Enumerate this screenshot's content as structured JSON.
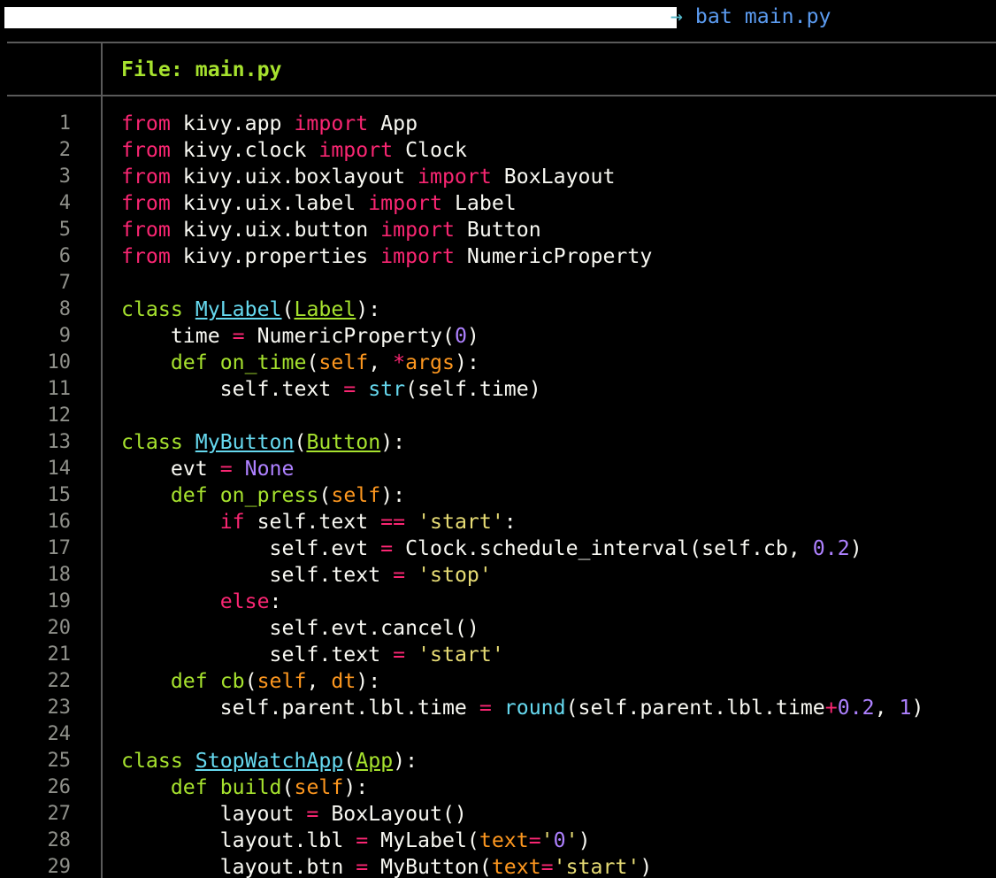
{
  "terminal": {
    "prompt_arrow": "→",
    "command": " bat main.py"
  },
  "header": {
    "label": "File: ",
    "filename": "main.py"
  },
  "colors": {
    "keyword": "#f92672",
    "function": "#a6e22e",
    "class": "#66d9ef",
    "number": "#ae81ff",
    "string": "#e6db74",
    "parameter": "#fd971f",
    "text": "#f8f8f2",
    "line_number": "#8f908a",
    "rule": "#5a5a5a"
  },
  "lines": [
    [
      [
        "kw",
        "from"
      ],
      [
        "tx",
        " kivy.app "
      ],
      [
        "kw",
        "import"
      ],
      [
        "tx",
        " App"
      ]
    ],
    [
      [
        "kw",
        "from"
      ],
      [
        "tx",
        " kivy.clock "
      ],
      [
        "kw",
        "import"
      ],
      [
        "tx",
        " Clock"
      ]
    ],
    [
      [
        "kw",
        "from"
      ],
      [
        "tx",
        " kivy.uix.boxlayout "
      ],
      [
        "kw",
        "import"
      ],
      [
        "tx",
        " BoxLayout"
      ]
    ],
    [
      [
        "kw",
        "from"
      ],
      [
        "tx",
        " kivy.uix.label "
      ],
      [
        "kw",
        "import"
      ],
      [
        "tx",
        " Label"
      ]
    ],
    [
      [
        "kw",
        "from"
      ],
      [
        "tx",
        " kivy.uix.button "
      ],
      [
        "kw",
        "import"
      ],
      [
        "tx",
        " Button"
      ]
    ],
    [
      [
        "kw",
        "from"
      ],
      [
        "tx",
        " kivy.properties "
      ],
      [
        "kw",
        "import"
      ],
      [
        "tx",
        " NumericProperty"
      ]
    ],
    [],
    [
      [
        "fn",
        "class"
      ],
      [
        "tx",
        " "
      ],
      [
        "cls",
        "MyLabel"
      ],
      [
        "tx",
        "("
      ],
      [
        "inh",
        "Label"
      ],
      [
        "tx",
        "):"
      ]
    ],
    [
      [
        "tx",
        "    time "
      ],
      [
        "op",
        "="
      ],
      [
        "tx",
        " NumericProperty("
      ],
      [
        "num",
        "0"
      ],
      [
        "tx",
        ")"
      ]
    ],
    [
      [
        "tx",
        "    "
      ],
      [
        "fn",
        "def"
      ],
      [
        "tx",
        " "
      ],
      [
        "fn",
        "on_time"
      ],
      [
        "tx",
        "("
      ],
      [
        "prm",
        "self"
      ],
      [
        "tx",
        ", "
      ],
      [
        "op",
        "*"
      ],
      [
        "prm",
        "args"
      ],
      [
        "tx",
        "):"
      ]
    ],
    [
      [
        "tx",
        "        self.text "
      ],
      [
        "op",
        "="
      ],
      [
        "tx",
        " "
      ],
      [
        "bi",
        "str"
      ],
      [
        "tx",
        "(self.time)"
      ]
    ],
    [],
    [
      [
        "fn",
        "class"
      ],
      [
        "tx",
        " "
      ],
      [
        "cls",
        "MyButton"
      ],
      [
        "tx",
        "("
      ],
      [
        "inh",
        "Button"
      ],
      [
        "tx",
        "):"
      ]
    ],
    [
      [
        "tx",
        "    evt "
      ],
      [
        "op",
        "="
      ],
      [
        "tx",
        " "
      ],
      [
        "num",
        "None"
      ]
    ],
    [
      [
        "tx",
        "    "
      ],
      [
        "fn",
        "def"
      ],
      [
        "tx",
        " "
      ],
      [
        "fn",
        "on_press"
      ],
      [
        "tx",
        "("
      ],
      [
        "prm",
        "self"
      ],
      [
        "tx",
        "):"
      ]
    ],
    [
      [
        "tx",
        "        "
      ],
      [
        "kw",
        "if"
      ],
      [
        "tx",
        " self.text "
      ],
      [
        "op",
        "=="
      ],
      [
        "tx",
        " "
      ],
      [
        "str",
        "'start'"
      ],
      [
        "tx",
        ":"
      ]
    ],
    [
      [
        "tx",
        "            self.evt "
      ],
      [
        "op",
        "="
      ],
      [
        "tx",
        " Clock.schedule_interval(self.cb, "
      ],
      [
        "num",
        "0.2"
      ],
      [
        "tx",
        ")"
      ]
    ],
    [
      [
        "tx",
        "            self.text "
      ],
      [
        "op",
        "="
      ],
      [
        "tx",
        " "
      ],
      [
        "str",
        "'stop'"
      ]
    ],
    [
      [
        "tx",
        "        "
      ],
      [
        "kw",
        "else"
      ],
      [
        "tx",
        ":"
      ]
    ],
    [
      [
        "tx",
        "            self.evt.cancel()"
      ]
    ],
    [
      [
        "tx",
        "            self.text "
      ],
      [
        "op",
        "="
      ],
      [
        "tx",
        " "
      ],
      [
        "str",
        "'start'"
      ]
    ],
    [
      [
        "tx",
        "    "
      ],
      [
        "fn",
        "def"
      ],
      [
        "tx",
        " "
      ],
      [
        "fn",
        "cb"
      ],
      [
        "tx",
        "("
      ],
      [
        "prm",
        "self"
      ],
      [
        "tx",
        ", "
      ],
      [
        "prm",
        "dt"
      ],
      [
        "tx",
        "):"
      ]
    ],
    [
      [
        "tx",
        "        self.parent.lbl.time "
      ],
      [
        "op",
        "="
      ],
      [
        "tx",
        " "
      ],
      [
        "bi",
        "round"
      ],
      [
        "tx",
        "(self.parent.lbl.time"
      ],
      [
        "op",
        "+"
      ],
      [
        "num",
        "0.2"
      ],
      [
        "tx",
        ", "
      ],
      [
        "num",
        "1"
      ],
      [
        "tx",
        ")"
      ]
    ],
    [],
    [
      [
        "fn",
        "class"
      ],
      [
        "tx",
        " "
      ],
      [
        "cls",
        "StopWatchApp"
      ],
      [
        "tx",
        "("
      ],
      [
        "inh",
        "App"
      ],
      [
        "tx",
        "):"
      ]
    ],
    [
      [
        "tx",
        "    "
      ],
      [
        "fn",
        "def"
      ],
      [
        "tx",
        " "
      ],
      [
        "fn",
        "build"
      ],
      [
        "tx",
        "("
      ],
      [
        "prm",
        "self"
      ],
      [
        "tx",
        "):"
      ]
    ],
    [
      [
        "tx",
        "        layout "
      ],
      [
        "op",
        "="
      ],
      [
        "tx",
        " BoxLayout()"
      ]
    ],
    [
      [
        "tx",
        "        layout.lbl "
      ],
      [
        "op",
        "="
      ],
      [
        "tx",
        " MyLabel("
      ],
      [
        "prm",
        "text"
      ],
      [
        "op",
        "="
      ],
      [
        "str",
        "'"
      ],
      [
        "num",
        "0"
      ],
      [
        "str",
        "'"
      ],
      [
        "tx",
        ")"
      ]
    ],
    [
      [
        "tx",
        "        layout.btn "
      ],
      [
        "op",
        "="
      ],
      [
        "tx",
        " MyButton("
      ],
      [
        "prm",
        "text"
      ],
      [
        "op",
        "="
      ],
      [
        "str",
        "'start'"
      ],
      [
        "tx",
        ")"
      ]
    ]
  ],
  "line_numbers": [
    "1",
    "2",
    "3",
    "4",
    "5",
    "6",
    "7",
    "8",
    "9",
    "10",
    "11",
    "12",
    "13",
    "14",
    "15",
    "16",
    "17",
    "18",
    "19",
    "20",
    "21",
    "22",
    "23",
    "24",
    "25",
    "26",
    "27",
    "28",
    "29"
  ]
}
